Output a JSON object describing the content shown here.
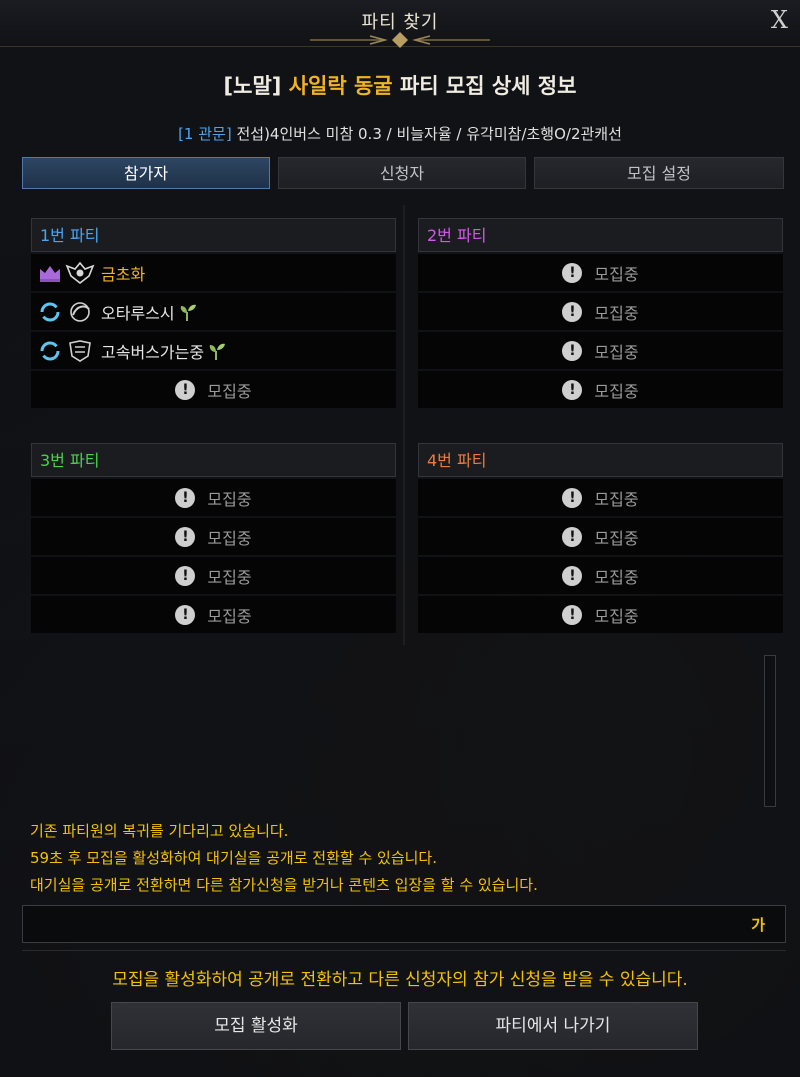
{
  "window": {
    "title": "파티 찾기",
    "close_glyph": "X"
  },
  "header": {
    "prefix": "[노말]",
    "dungeon": "사일락 동굴",
    "suffix": "파티 모집 상세 정보",
    "gate_tag": "[1 관문]",
    "conditions": "전섭)4인버스 미참 0.3 / 비늘자율 / 유각미참/초행O/2관캐선"
  },
  "tabs": [
    {
      "label": "참가자",
      "active": true
    },
    {
      "label": "신청자",
      "active": false
    },
    {
      "label": "모집 설정",
      "active": false
    }
  ],
  "recruiting_label": "모집중",
  "parties": [
    {
      "title": "1번 파티",
      "color": "#4aa4f0",
      "members": [
        {
          "name": "금초화",
          "leader": true,
          "name_color": "#f2b323",
          "class_icon": "class-emblem-icon",
          "sprout": false
        },
        {
          "name": "오타루스시",
          "leader": false,
          "name_color": "#e6e6e6",
          "class_icon": "class-emblem-icon",
          "sprout": true
        },
        {
          "name": "고속버스가는중",
          "leader": false,
          "name_color": "#e6e6e6",
          "class_icon": "class-emblem-icon",
          "sprout": true
        }
      ]
    },
    {
      "title": "2번 파티",
      "color": "#d05ae6",
      "members": []
    },
    {
      "title": "3번 파티",
      "color": "#4fd04a",
      "members": []
    },
    {
      "title": "4번 파티",
      "color": "#f07a3a",
      "members": []
    }
  ],
  "messages": [
    "기존 파티원의 복귀를 기다리고 있습니다.",
    "59초 후 모집을 활성화하여 대기실을 공개로 전환할 수 있습니다.",
    "대기실을 공개로 전환하면 다른 참가신청을 받거나 콘텐츠 입장을 할 수 있습니다."
  ],
  "chat": {
    "lang_indicator": "가"
  },
  "notice": "모집을 활성화하여 공개로 전환하고 다른 신청자의 참가 신청을 받을 수 있습니다.",
  "buttons": {
    "activate": "모집 활성화",
    "leave": "파티에서 나가기"
  },
  "colors": {
    "accent_gold": "#f2b323",
    "message_yellow": "#f2c200",
    "tab_active_blue": "#4f79a6"
  }
}
